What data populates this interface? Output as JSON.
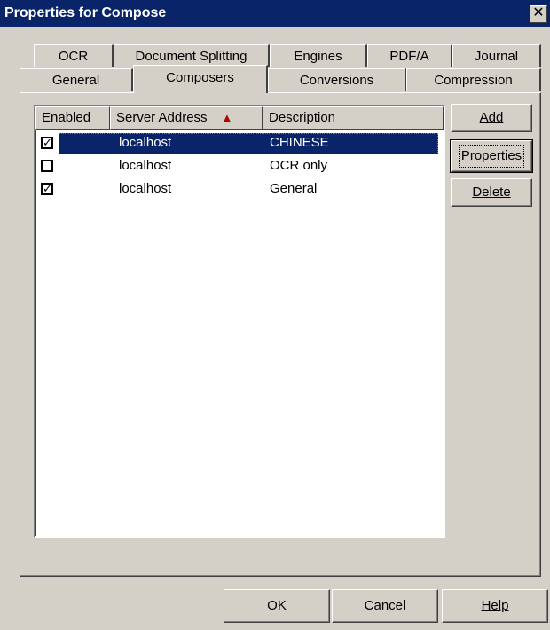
{
  "window": {
    "title": "Properties for Compose",
    "close_glyph": "✕"
  },
  "tabs_back": [
    "OCR",
    "Document Splitting",
    "Engines",
    "PDF/A",
    "Journal"
  ],
  "tabs_front": [
    "General",
    "Composers",
    "Conversions",
    "Compression"
  ],
  "selected_tab": "Composers",
  "list": {
    "columns": [
      "Enabled",
      "Server Address",
      "Description"
    ],
    "sort_indicator": "▲",
    "rows": [
      {
        "enabled": true,
        "check": "✓",
        "address": "localhost",
        "description": "CHINESE",
        "selected": true
      },
      {
        "enabled": false,
        "check": "",
        "address": "localhost",
        "description": "OCR only",
        "selected": false
      },
      {
        "enabled": true,
        "check": "✓",
        "address": "localhost",
        "description": "General",
        "selected": false
      }
    ]
  },
  "side_buttons": {
    "add": "Add",
    "properties": "Properties",
    "delete": "Delete"
  },
  "footer_buttons": {
    "ok": "OK",
    "cancel": "Cancel",
    "help": "Help"
  },
  "colors": {
    "titlebar": "#0a246a",
    "selection": "#0a246a",
    "sort_arrow": "#b00000",
    "face": "#d4d0c8"
  }
}
